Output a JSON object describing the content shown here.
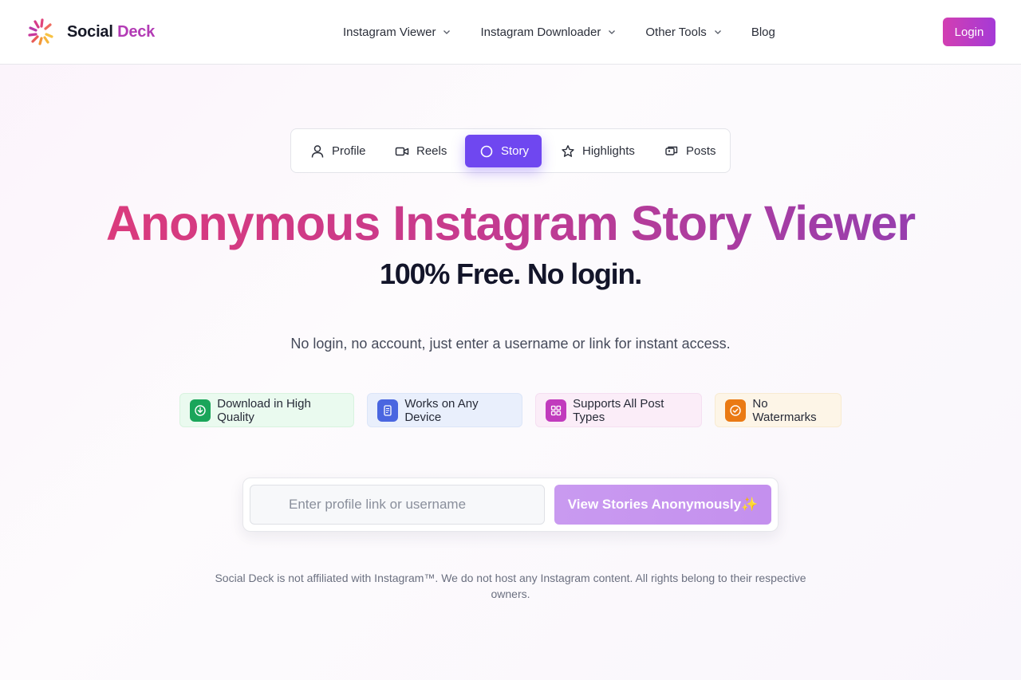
{
  "header": {
    "brand_main": "Social",
    "brand_accent": "Deck",
    "nav": [
      {
        "label": "Instagram Viewer",
        "has_dropdown": true
      },
      {
        "label": "Instagram Downloader",
        "has_dropdown": true
      },
      {
        "label": "Other Tools",
        "has_dropdown": true
      },
      {
        "label": "Blog",
        "has_dropdown": false
      }
    ],
    "login_label": "Login"
  },
  "tabs": [
    {
      "label": "Profile",
      "icon": "user-icon",
      "active": false
    },
    {
      "label": "Reels",
      "icon": "video-icon",
      "active": false
    },
    {
      "label": "Story",
      "icon": "circle-icon",
      "active": true
    },
    {
      "label": "Highlights",
      "icon": "star-icon",
      "active": false
    },
    {
      "label": "Posts",
      "icon": "images-icon",
      "active": false
    }
  ],
  "hero": {
    "title": "Anonymous Instagram Story Viewer",
    "subtitle": "100% Free. No login.",
    "description": "No login, no account, just enter a username or link for instant access."
  },
  "features": [
    {
      "label": "Download in High Quality",
      "icon": "download-icon",
      "color": "#1aa55a"
    },
    {
      "label": "Works on Any Device",
      "icon": "device-icon",
      "color": "#4a66e0"
    },
    {
      "label": "Supports All Post Types",
      "icon": "grid-icon",
      "color": "#c13bbd"
    },
    {
      "label": "No Watermarks",
      "icon": "check-circle-icon",
      "color": "#ea7a14"
    }
  ],
  "search": {
    "placeholder": "Enter profile link or username",
    "value": "",
    "button_label": "View Stories Anonymously✨"
  },
  "disclaimer": "Social Deck is not affiliated with Instagram™. We do not host any Instagram content. All rights belong to their respective owners.",
  "colors": {
    "accent_purple": "#6f47f0",
    "brand_pink": "#d23fb2",
    "title_gradient_start": "#e03b78",
    "title_gradient_end": "#8b3fb6"
  }
}
